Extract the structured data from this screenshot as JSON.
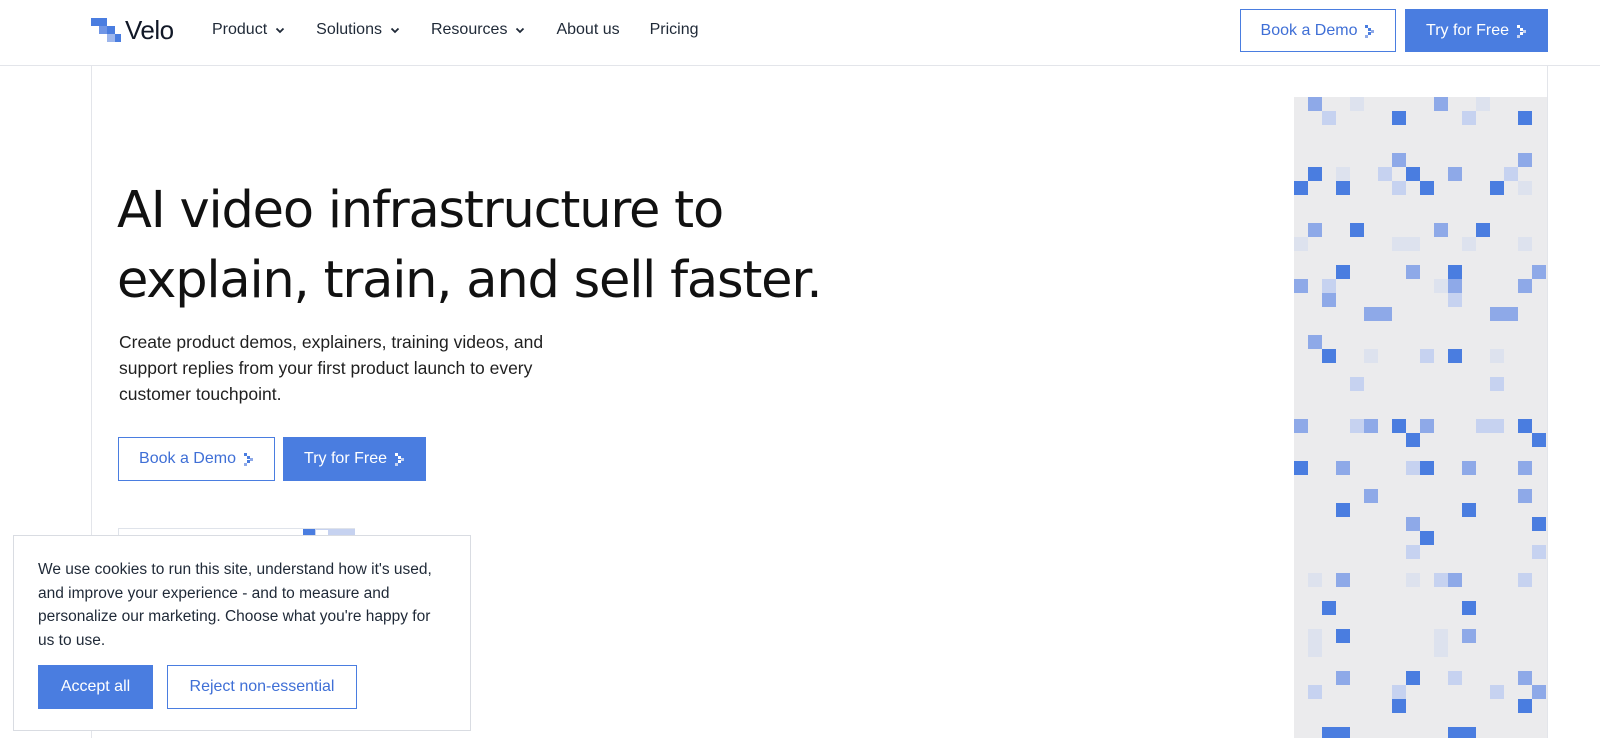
{
  "brand": {
    "name": "Velo",
    "accent": "#4a7de0"
  },
  "nav": {
    "items": [
      {
        "label": "Product",
        "has_dropdown": true
      },
      {
        "label": "Solutions",
        "has_dropdown": true
      },
      {
        "label": "Resources",
        "has_dropdown": true
      },
      {
        "label": "About us",
        "has_dropdown": false
      },
      {
        "label": "Pricing",
        "has_dropdown": false
      }
    ],
    "book_demo": "Book a Demo",
    "try_free": "Try for Free"
  },
  "hero": {
    "title_line1": "AI video infrastructure to",
    "title_line2": "explain, train, and sell faster.",
    "subtitle": "Create product demos, explainers, training videos, and support replies from your first product launch to every customer touchpoint.",
    "book_demo": "Book a Demo",
    "try_free": "Try for Free"
  },
  "cookie_banner": {
    "text": "We use cookies to run this site, understand how it's used, and improve your experience - and to measure and personalize our marketing. Choose what you're happy for us to use.",
    "accept": "Accept all",
    "reject": "Reject non-essential"
  },
  "icons": {
    "logo": "velo-logo-icon",
    "dropdown": "chevron-down-icon",
    "cta_arrow": "pixel-arrow-icon"
  },
  "colors": {
    "accent": "#4a7de0",
    "pixel_dark": "#4a7de0",
    "pixel_mid": "#8ea9e8",
    "pixel_light": "#c6d2f0",
    "pixel_faint": "#dde2ee",
    "panel_bg": "#ebebed"
  }
}
